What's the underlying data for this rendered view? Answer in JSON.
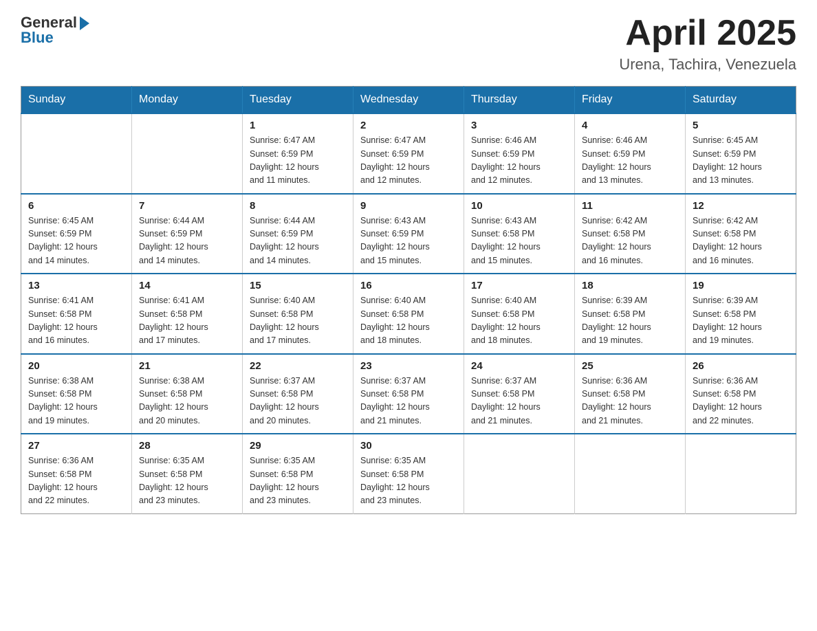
{
  "header": {
    "logo_text": "General",
    "logo_sub": "Blue",
    "month": "April 2025",
    "location": "Urena, Tachira, Venezuela"
  },
  "weekdays": [
    "Sunday",
    "Monday",
    "Tuesday",
    "Wednesday",
    "Thursday",
    "Friday",
    "Saturday"
  ],
  "weeks": [
    [
      {
        "day": "",
        "info": ""
      },
      {
        "day": "",
        "info": ""
      },
      {
        "day": "1",
        "info": "Sunrise: 6:47 AM\nSunset: 6:59 PM\nDaylight: 12 hours\nand 11 minutes."
      },
      {
        "day": "2",
        "info": "Sunrise: 6:47 AM\nSunset: 6:59 PM\nDaylight: 12 hours\nand 12 minutes."
      },
      {
        "day": "3",
        "info": "Sunrise: 6:46 AM\nSunset: 6:59 PM\nDaylight: 12 hours\nand 12 minutes."
      },
      {
        "day": "4",
        "info": "Sunrise: 6:46 AM\nSunset: 6:59 PM\nDaylight: 12 hours\nand 13 minutes."
      },
      {
        "day": "5",
        "info": "Sunrise: 6:45 AM\nSunset: 6:59 PM\nDaylight: 12 hours\nand 13 minutes."
      }
    ],
    [
      {
        "day": "6",
        "info": "Sunrise: 6:45 AM\nSunset: 6:59 PM\nDaylight: 12 hours\nand 14 minutes."
      },
      {
        "day": "7",
        "info": "Sunrise: 6:44 AM\nSunset: 6:59 PM\nDaylight: 12 hours\nand 14 minutes."
      },
      {
        "day": "8",
        "info": "Sunrise: 6:44 AM\nSunset: 6:59 PM\nDaylight: 12 hours\nand 14 minutes."
      },
      {
        "day": "9",
        "info": "Sunrise: 6:43 AM\nSunset: 6:59 PM\nDaylight: 12 hours\nand 15 minutes."
      },
      {
        "day": "10",
        "info": "Sunrise: 6:43 AM\nSunset: 6:58 PM\nDaylight: 12 hours\nand 15 minutes."
      },
      {
        "day": "11",
        "info": "Sunrise: 6:42 AM\nSunset: 6:58 PM\nDaylight: 12 hours\nand 16 minutes."
      },
      {
        "day": "12",
        "info": "Sunrise: 6:42 AM\nSunset: 6:58 PM\nDaylight: 12 hours\nand 16 minutes."
      }
    ],
    [
      {
        "day": "13",
        "info": "Sunrise: 6:41 AM\nSunset: 6:58 PM\nDaylight: 12 hours\nand 16 minutes."
      },
      {
        "day": "14",
        "info": "Sunrise: 6:41 AM\nSunset: 6:58 PM\nDaylight: 12 hours\nand 17 minutes."
      },
      {
        "day": "15",
        "info": "Sunrise: 6:40 AM\nSunset: 6:58 PM\nDaylight: 12 hours\nand 17 minutes."
      },
      {
        "day": "16",
        "info": "Sunrise: 6:40 AM\nSunset: 6:58 PM\nDaylight: 12 hours\nand 18 minutes."
      },
      {
        "day": "17",
        "info": "Sunrise: 6:40 AM\nSunset: 6:58 PM\nDaylight: 12 hours\nand 18 minutes."
      },
      {
        "day": "18",
        "info": "Sunrise: 6:39 AM\nSunset: 6:58 PM\nDaylight: 12 hours\nand 19 minutes."
      },
      {
        "day": "19",
        "info": "Sunrise: 6:39 AM\nSunset: 6:58 PM\nDaylight: 12 hours\nand 19 minutes."
      }
    ],
    [
      {
        "day": "20",
        "info": "Sunrise: 6:38 AM\nSunset: 6:58 PM\nDaylight: 12 hours\nand 19 minutes."
      },
      {
        "day": "21",
        "info": "Sunrise: 6:38 AM\nSunset: 6:58 PM\nDaylight: 12 hours\nand 20 minutes."
      },
      {
        "day": "22",
        "info": "Sunrise: 6:37 AM\nSunset: 6:58 PM\nDaylight: 12 hours\nand 20 minutes."
      },
      {
        "day": "23",
        "info": "Sunrise: 6:37 AM\nSunset: 6:58 PM\nDaylight: 12 hours\nand 21 minutes."
      },
      {
        "day": "24",
        "info": "Sunrise: 6:37 AM\nSunset: 6:58 PM\nDaylight: 12 hours\nand 21 minutes."
      },
      {
        "day": "25",
        "info": "Sunrise: 6:36 AM\nSunset: 6:58 PM\nDaylight: 12 hours\nand 21 minutes."
      },
      {
        "day": "26",
        "info": "Sunrise: 6:36 AM\nSunset: 6:58 PM\nDaylight: 12 hours\nand 22 minutes."
      }
    ],
    [
      {
        "day": "27",
        "info": "Sunrise: 6:36 AM\nSunset: 6:58 PM\nDaylight: 12 hours\nand 22 minutes."
      },
      {
        "day": "28",
        "info": "Sunrise: 6:35 AM\nSunset: 6:58 PM\nDaylight: 12 hours\nand 23 minutes."
      },
      {
        "day": "29",
        "info": "Sunrise: 6:35 AM\nSunset: 6:58 PM\nDaylight: 12 hours\nand 23 minutes."
      },
      {
        "day": "30",
        "info": "Sunrise: 6:35 AM\nSunset: 6:58 PM\nDaylight: 12 hours\nand 23 minutes."
      },
      {
        "day": "",
        "info": ""
      },
      {
        "day": "",
        "info": ""
      },
      {
        "day": "",
        "info": ""
      }
    ]
  ]
}
